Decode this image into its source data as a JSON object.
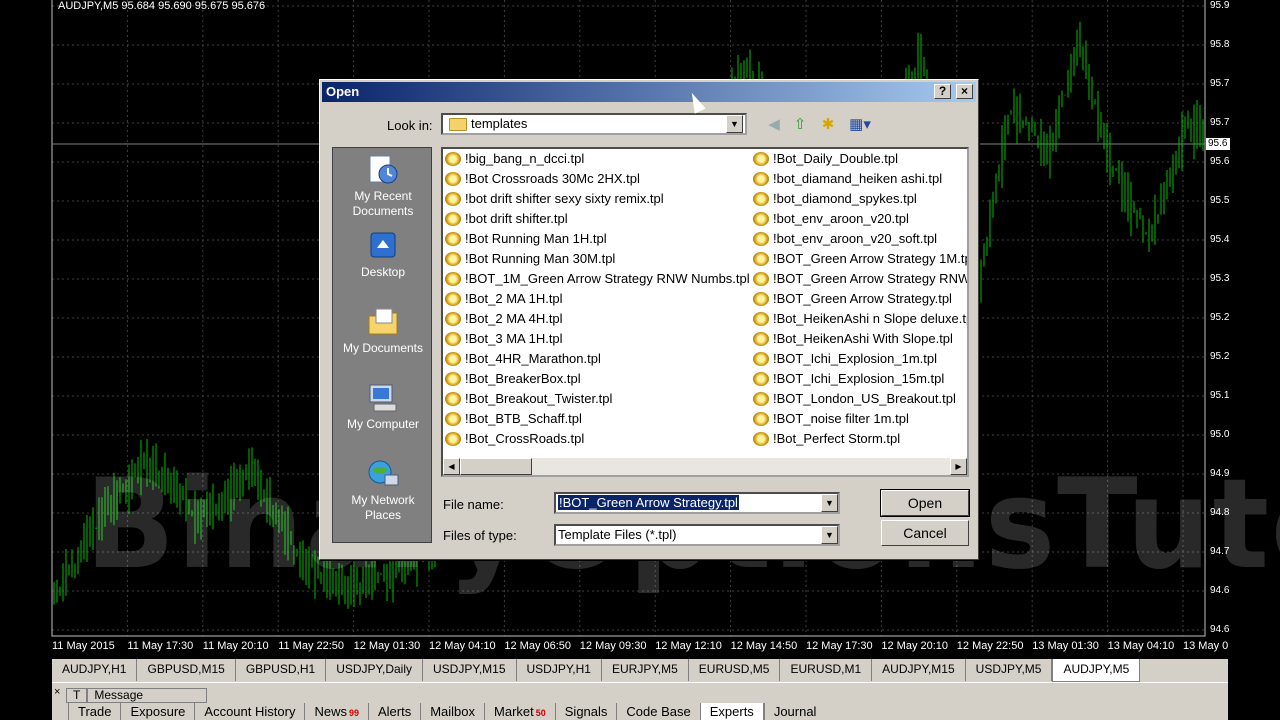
{
  "chart": {
    "title": "AUDJPY,M5  95.684 95.690 95.675 95.676",
    "watermark": "BinaryOptionsTutor.com",
    "current_price": "95.6",
    "colors": {
      "background": "#000000",
      "candles": "#00c000",
      "text": "#ffffff"
    },
    "price_labels": [
      "95.9",
      "95.8",
      "95.7",
      "95.7",
      "95.6",
      "95.5",
      "95.4",
      "95.3",
      "95.2",
      "95.2",
      "95.1",
      "95.0",
      "94.9",
      "94.8",
      "94.7",
      "94.6",
      "94.6"
    ],
    "time_labels": [
      "11 May 2015",
      "11 May 17:30",
      "11 May 20:10",
      "11 May 22:50",
      "12 May 01:30",
      "12 May 04:10",
      "12 May 06:50",
      "12 May 09:30",
      "12 May 12:10",
      "12 May 14:50",
      "12 May 17:30",
      "12 May 20:10",
      "12 May 22:50",
      "13 May 01:30",
      "13 May 04:10",
      "13 May 0"
    ]
  },
  "symbol_tabs": [
    {
      "label": "AUDJPY,H1"
    },
    {
      "label": "GBPUSD,M15"
    },
    {
      "label": "GBPUSD,H1"
    },
    {
      "label": "USDJPY,Daily"
    },
    {
      "label": "USDJPY,M15"
    },
    {
      "label": "USDJPY,H1"
    },
    {
      "label": "EURJPY,M5"
    },
    {
      "label": "EURUSD,M5"
    },
    {
      "label": "EURUSD,M1"
    },
    {
      "label": "AUDJPY,M15"
    },
    {
      "label": "USDJPY,M5"
    },
    {
      "label": "AUDJPY,M5",
      "active": true
    }
  ],
  "terminal": {
    "close_glyph": "×",
    "columns": [
      "T",
      "Message"
    ],
    "tabs": [
      {
        "label": "Trade"
      },
      {
        "label": "Exposure"
      },
      {
        "label": "Account History"
      },
      {
        "label": "News",
        "count": "99"
      },
      {
        "label": "Alerts"
      },
      {
        "label": "Mailbox"
      },
      {
        "label": "Market",
        "count": "50"
      },
      {
        "label": "Signals"
      },
      {
        "label": "Code Base"
      },
      {
        "label": "Experts",
        "active": true
      },
      {
        "label": "Journal"
      }
    ]
  },
  "dialog": {
    "title": "Open",
    "help_glyph": "?",
    "close_glyph": "×",
    "look_in_label": "Look in:",
    "look_in_value": "templates",
    "places": [
      {
        "label": "My Recent Documents",
        "icon": "recent-documents-icon"
      },
      {
        "label": "Desktop",
        "icon": "desktop-icon"
      },
      {
        "label": "My Documents",
        "icon": "my-documents-icon"
      },
      {
        "label": "My Computer",
        "icon": "my-computer-icon"
      },
      {
        "label": "My Network Places",
        "icon": "network-places-icon"
      }
    ],
    "files_col1": [
      "!big_bang_n_dcci.tpl",
      "!Bot Crossroads 30Mc 2HX.tpl",
      "!bot drift shifter sexy sixty remix.tpl",
      "!bot drift shifter.tpl",
      "!Bot Running Man 1H.tpl",
      "!Bot Running Man 30M.tpl",
      "!BOT_1M_Green Arrow Strategy RNW Numbs.tpl",
      "!Bot_2 MA 1H.tpl",
      "!Bot_2 MA 4H.tpl",
      "!Bot_3 MA 1H.tpl",
      "!Bot_4HR_Marathon.tpl",
      "!Bot_BreakerBox.tpl",
      "!Bot_Breakout_Twister.tpl",
      "!Bot_BTB_Schaff.tpl",
      "!Bot_CrossRoads.tpl"
    ],
    "files_col2": [
      "!Bot_Daily_Double.tpl",
      "!bot_diamand_heiken ashi.tpl",
      "!bot_diamond_spykes.tpl",
      "!bot_env_aroon_v20.tpl",
      "!bot_env_aroon_v20_soft.tpl",
      "!BOT_Green Arrow Strategy 1M.tp",
      "!BOT_Green Arrow Strategy RNW",
      "!BOT_Green Arrow Strategy.tpl",
      "!Bot_HeikenAshi n Slope deluxe.tpl",
      "!Bot_HeikenAshi With Slope.tpl",
      "!BOT_Ichi_Explosion_1m.tpl",
      "!BOT_Ichi_Explosion_15m.tpl",
      "!BOT_London_US_Breakout.tpl",
      "!BOT_noise filter 1m.tpl",
      "!Bot_Perfect Storm.tpl"
    ],
    "file_name_label": "File name:",
    "file_name_value": "!BOT_Green Arrow Strategy.tpl",
    "files_of_type_label": "Files of type:",
    "files_of_type_value": "Template Files (*.tpl)",
    "open_button": "Open",
    "cancel_button": "Cancel"
  }
}
